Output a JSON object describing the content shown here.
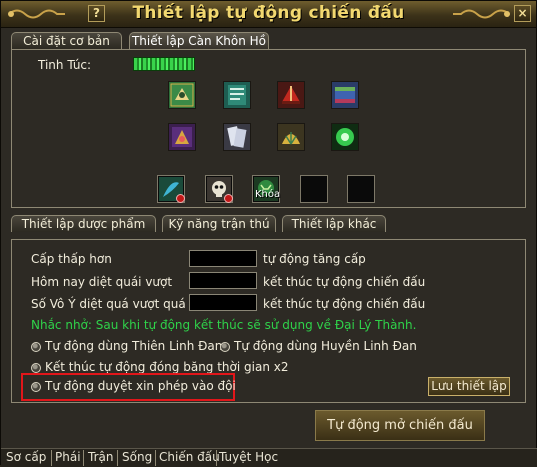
{
  "window": {
    "title": "Thiết lập tự động chiến đấu",
    "help_glyph": "?",
    "close_glyph": "×"
  },
  "tabs_top": [
    {
      "label": "Cài đặt cơ bản",
      "active": false
    },
    {
      "label": "Thiết lập Càn Khôn Hồ",
      "active": true
    }
  ],
  "tinh_tuc": {
    "label": "Tinh Túc:"
  },
  "skill_icons": [
    "bird-pattern-skill-icon",
    "scroll-skill-icon",
    "red-fan-skill-icon",
    "book-skill-icon",
    "purple-lotus-skill-icon",
    "paper-talisman-skill-icon",
    "golden-fan-skill-icon",
    "green-orb-skill-icon"
  ],
  "slots": [
    {
      "icon": "blue-leaf-skill-icon",
      "badge": true,
      "lock": ""
    },
    {
      "icon": "skull-skill-icon",
      "badge": true,
      "lock": ""
    },
    {
      "icon": "green-beast-skill-icon",
      "badge": false,
      "lock": "Khóa"
    },
    {
      "icon": "empty-slot",
      "badge": false,
      "lock": ""
    },
    {
      "icon": "empty-slot",
      "badge": false,
      "lock": ""
    }
  ],
  "tabs_mid": [
    {
      "label": "Thiết lập dược phẩm"
    },
    {
      "label": "Kỹ năng trận thú"
    },
    {
      "label": "Thiết lập khác"
    }
  ],
  "settings": {
    "row1": {
      "left": "Cấp thấp hơn",
      "right": "tự động tăng cấp",
      "value": ""
    },
    "row2": {
      "left": "Hôm nay diệt quái vượt",
      "right": "kết thúc tự động chiến đấu",
      "value": ""
    },
    "row3": {
      "left": "Số Vô Ý diệt quá vượt quá",
      "right": "kết thúc tự động chiến đấu",
      "value": ""
    },
    "hint": "Nhắc nhở: Sau khi tự động kết thúc sẽ sử dụng về Đại Lý Thành.",
    "opt1": "Tự động dùng Thiên Linh Đan",
    "opt2": "Tự động dùng Huyền Linh Đan",
    "opt3": "Kết thúc tự động đóng băng thời gian x2",
    "opt4": "Tự động duyệt xin phép vào đội",
    "save_label": "Lưu thiết lập"
  },
  "start_button": {
    "label": "Tự động mở chiến đấu"
  },
  "bottom_tabs": [
    "Sơ cấp",
    "Phái",
    "Trận",
    "Sống",
    "Chiến đấu",
    "Tuyệt Học"
  ],
  "colors": {
    "title": "#f2d870",
    "hint": "#2fd24a",
    "highlight": "#e2161a",
    "background": "#2d2a24"
  }
}
